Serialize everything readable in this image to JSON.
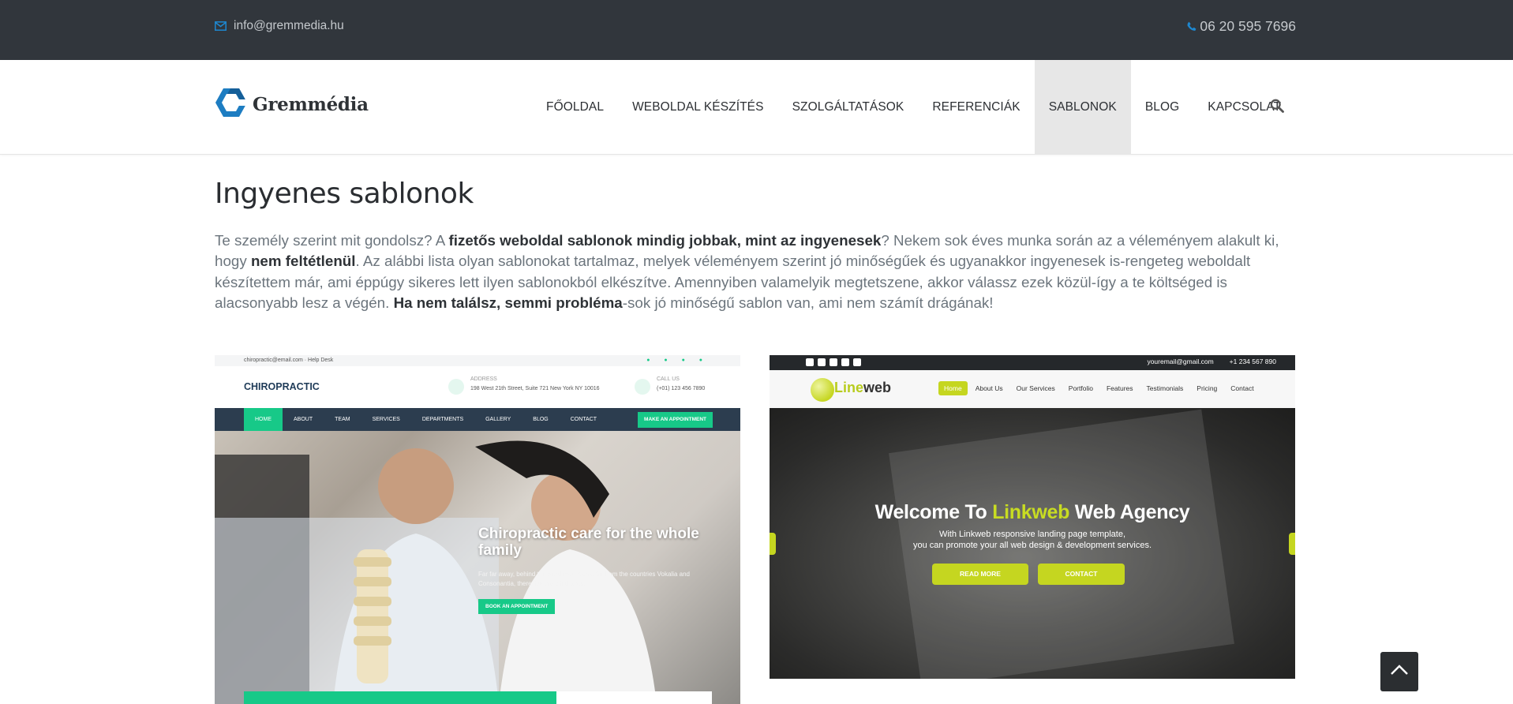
{
  "topbar": {
    "email": "info@gremmedia.hu",
    "phone": "06 20 595 7696",
    "icons": {
      "email": "envelope-icon",
      "phone": "phone-icon"
    }
  },
  "header": {
    "logo_text": "Gremmédia",
    "nav": [
      {
        "label": "FŐOLDAL",
        "active": false
      },
      {
        "label": "WEBOLDAL KÉSZÍTÉS",
        "active": false
      },
      {
        "label": "SZOLGÁLTATÁSOK",
        "active": false
      },
      {
        "label": "REFERENCIÁK",
        "active": false
      },
      {
        "label": "SABLONOK",
        "active": true
      },
      {
        "label": "BLOG",
        "active": false
      },
      {
        "label": "KAPCSOLAT",
        "active": false
      }
    ],
    "search_icon": "search-icon"
  },
  "main": {
    "title": "Ingyenes sablonok",
    "intro": {
      "p1": "Te személy szerint mit gondolsz? A ",
      "b1": "fizetős weboldal sablonok mindig jobbak, mint az ingyenesek",
      "p2": "? Nekem sok éves munka során az a véleményem alakult ki, hogy ",
      "b2": "nem feltétlenül",
      "p3": ". Az alábbi lista olyan sablonokat tartalmaz, melyek véleményem szerint jó minőségűek és ugyanakkor ingyenesek is-rengeteg weboldalt készítettem már, ami éppúgy sikeres lett ilyen sablonokból elkészítve. Amennyiben valamelyik megtetszene, akkor válassz ezek közül-így a te költséged is alacsonyabb lesz a végén. ",
      "b3": "Ha nem találsz, semmi probléma",
      "p4": "-sok jó minőségű sablon van, ami nem számít drágának!"
    }
  },
  "thumb1": {
    "topline": "chiropractic@email.com · Help Desk",
    "brand": "CHIROPRACTIC",
    "addr_label": "ADDRESS",
    "addr_value": "198 West 21th Street, Suite 721 New York NY 10016",
    "call_label": "CALL US",
    "call_value": "(+01) 123 456 7890",
    "menu": [
      "HOME",
      "ABOUT",
      "TEAM",
      "SERVICES",
      "DEPARTMENTS",
      "GALLERY",
      "BLOG",
      "CONTACT"
    ],
    "cta": "MAKE AN APPOINTMENT",
    "headline": "Chiropractic care for the whole family",
    "text": "Far far away, behind the word mountains, far from the countries Vokalia and Consonantia, there live the blind texts.",
    "book": "BOOK AN APPOINTMENT"
  },
  "thumb2": {
    "email": "youremail@gmail.com",
    "phone": "+1 234 567 890",
    "logo_a": "Line",
    "logo_b": "web",
    "menu": [
      "Home",
      "About Us",
      "Our Services",
      "Portfolio",
      "Features",
      "Testimonials",
      "Pricing",
      "Contact"
    ],
    "headline_a": "Welcome To ",
    "headline_b": "Linkweb",
    "headline_c": " Web Agency",
    "line1": "With Linkweb responsive landing page template,",
    "line2": "you can promote your all web design & development services.",
    "btn1": "READ MORE",
    "btn2": "CONTACT"
  },
  "scroll_top_icon": "chevron-up-icon",
  "colors": {
    "topbar": "#31363c",
    "accent_blue": "#1e7bc0",
    "nav_active_bg": "#e7e7e7"
  }
}
